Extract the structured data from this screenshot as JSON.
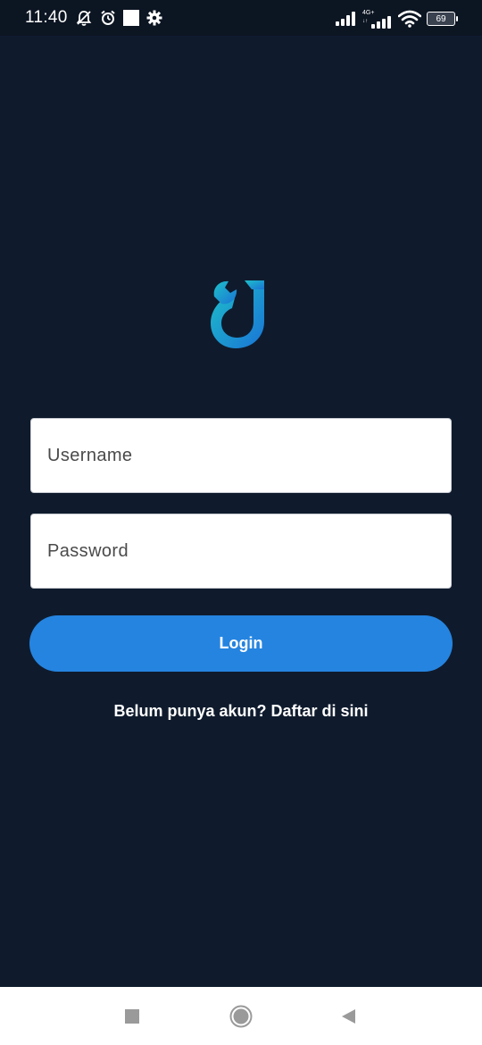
{
  "status_bar": {
    "time": "11:40",
    "network_label": "4G+",
    "battery_level": "69",
    "icons": [
      "muted-alarm-icon",
      "alarm-clock-icon",
      "notification-square-icon",
      "settings-gear-icon",
      "signal-icon",
      "lte-signal-icon",
      "wifi-icon",
      "battery-icon"
    ]
  },
  "logo": {
    "icon": "wrench-drop-logo",
    "gradient_start": "#1ec0c9",
    "gradient_end": "#1a74d6"
  },
  "form": {
    "username_placeholder": "Username",
    "password_placeholder": "Password",
    "login_label": "Login",
    "register_text": "Belum punya akun? Daftar di sini"
  },
  "colors": {
    "background": "#0f1b2d",
    "button": "#2584e0"
  },
  "nav_bar": {
    "icons": [
      "recent-apps-icon",
      "home-icon",
      "back-icon"
    ]
  }
}
